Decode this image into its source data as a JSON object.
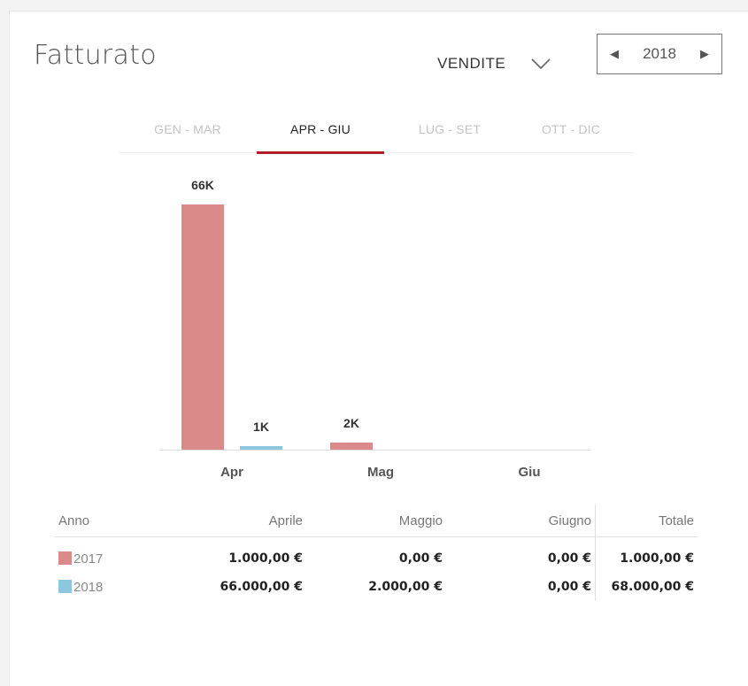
{
  "header": {
    "title": "Fatturato",
    "sales_select": "VENDITE",
    "year": "2018"
  },
  "tabs": [
    {
      "label": "GEN - MAR",
      "active": false
    },
    {
      "label": "APR - GIU",
      "active": true
    },
    {
      "label": "LUG - SET",
      "active": false
    },
    {
      "label": "OTT - DIC",
      "active": false
    }
  ],
  "colors": {
    "series_2017": "#d98a89",
    "series_2018": "#8cc6df",
    "accent": "#b01e2e"
  },
  "chart_data": {
    "type": "bar",
    "categories": [
      "Apr",
      "Mag",
      "Giu"
    ],
    "series": [
      {
        "name": "2017",
        "values": [
          66000,
          2000,
          0
        ],
        "labels": [
          "66K",
          "2K",
          ""
        ]
      },
      {
        "name": "2018",
        "values": [
          1000,
          0,
          0
        ],
        "labels": [
          "1K",
          "",
          ""
        ]
      }
    ],
    "ylim": [
      0,
      66000
    ],
    "grid": false
  },
  "table": {
    "headers": [
      "Anno",
      "Aprile",
      "Maggio",
      "Giugno",
      "Totale"
    ],
    "rows": [
      {
        "year": "2017",
        "values": [
          "1.000,00 €",
          "0,00 €",
          "0,00 €",
          "1.000,00 €"
        ]
      },
      {
        "year": "2018",
        "values": [
          "66.000,00 €",
          "2.000,00 €",
          "0,00 €",
          "68.000,00 €"
        ]
      }
    ]
  }
}
